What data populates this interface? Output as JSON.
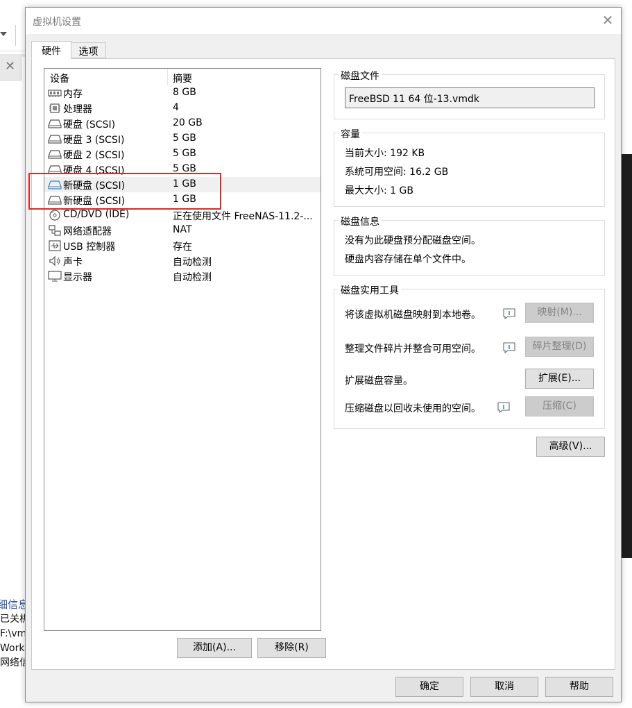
{
  "background": {
    "info_title": "细信息",
    "info_lines": [
      "已关机",
      "F:\\vm",
      "Work",
      "网络信"
    ]
  },
  "dialog": {
    "title": "虚拟机设置",
    "tabs": [
      {
        "label": "硬件",
        "active": true
      },
      {
        "label": "选项",
        "active": false
      }
    ],
    "device_list": {
      "columns": [
        "设备",
        "摘要"
      ],
      "rows": [
        {
          "icon": "memory-icon",
          "name": "内存",
          "summary": "8 GB"
        },
        {
          "icon": "processor-icon",
          "name": "处理器",
          "summary": "4"
        },
        {
          "icon": "hard-disk-icon",
          "name": "硬盘 (SCSI)",
          "summary": "20 GB"
        },
        {
          "icon": "hard-disk-icon",
          "name": "硬盘 3 (SCSI)",
          "summary": "5 GB"
        },
        {
          "icon": "hard-disk-icon",
          "name": "硬盘 2 (SCSI)",
          "summary": "5 GB"
        },
        {
          "icon": "hard-disk-icon",
          "name": "硬盘 4 (SCSI)",
          "summary": "5 GB"
        },
        {
          "icon": "hard-disk-icon",
          "name": "新硬盘 (SCSI)",
          "summary": "1 GB",
          "selected": true
        },
        {
          "icon": "hard-disk-icon",
          "name": "新硬盘 (SCSI)",
          "summary": "1 GB"
        },
        {
          "icon": "cd-dvd-icon",
          "name": "CD/DVD (IDE)",
          "summary": "正在使用文件 FreeNAS-11.2-..."
        },
        {
          "icon": "network-adapter-icon",
          "name": "网络适配器",
          "summary": "NAT"
        },
        {
          "icon": "usb-icon",
          "name": "USB 控制器",
          "summary": "存在"
        },
        {
          "icon": "sound-icon",
          "name": "声卡",
          "summary": "自动检测"
        },
        {
          "icon": "display-icon",
          "name": "显示器",
          "summary": "自动检测"
        }
      ]
    },
    "add_button": "添加(A)...",
    "remove_button": "移除(R)",
    "disk_file": {
      "title": "磁盘文件",
      "value": "FreeBSD 11 64 位-13.vmdk"
    },
    "capacity": {
      "title": "容量",
      "current_size": "当前大小: 192 KB",
      "available_space": "系统可用空间: 16.2 GB",
      "max_size": "最大大小: 1 GB"
    },
    "disk_info": {
      "title": "磁盘信息",
      "line1": "没有为此硬盘预分配磁盘空间。",
      "line2": "硬盘内容存储在单个文件中。"
    },
    "disk_tools": {
      "title": "磁盘实用工具",
      "map_text": "将该虚拟机磁盘映射到本地卷。",
      "map_button": "映射(M)...",
      "defrag_text": "整理文件碎片并整合可用空间。",
      "defrag_button": "碎片整理(D)",
      "expand_text": "扩展磁盘容量。",
      "expand_button": "扩展(E)...",
      "compact_text": "压缩磁盘以回收未使用的空间。",
      "compact_button": "压缩(C)"
    },
    "advanced_button": "高级(V)...",
    "ok_button": "确定",
    "cancel_button": "取消",
    "help_button": "帮助"
  }
}
